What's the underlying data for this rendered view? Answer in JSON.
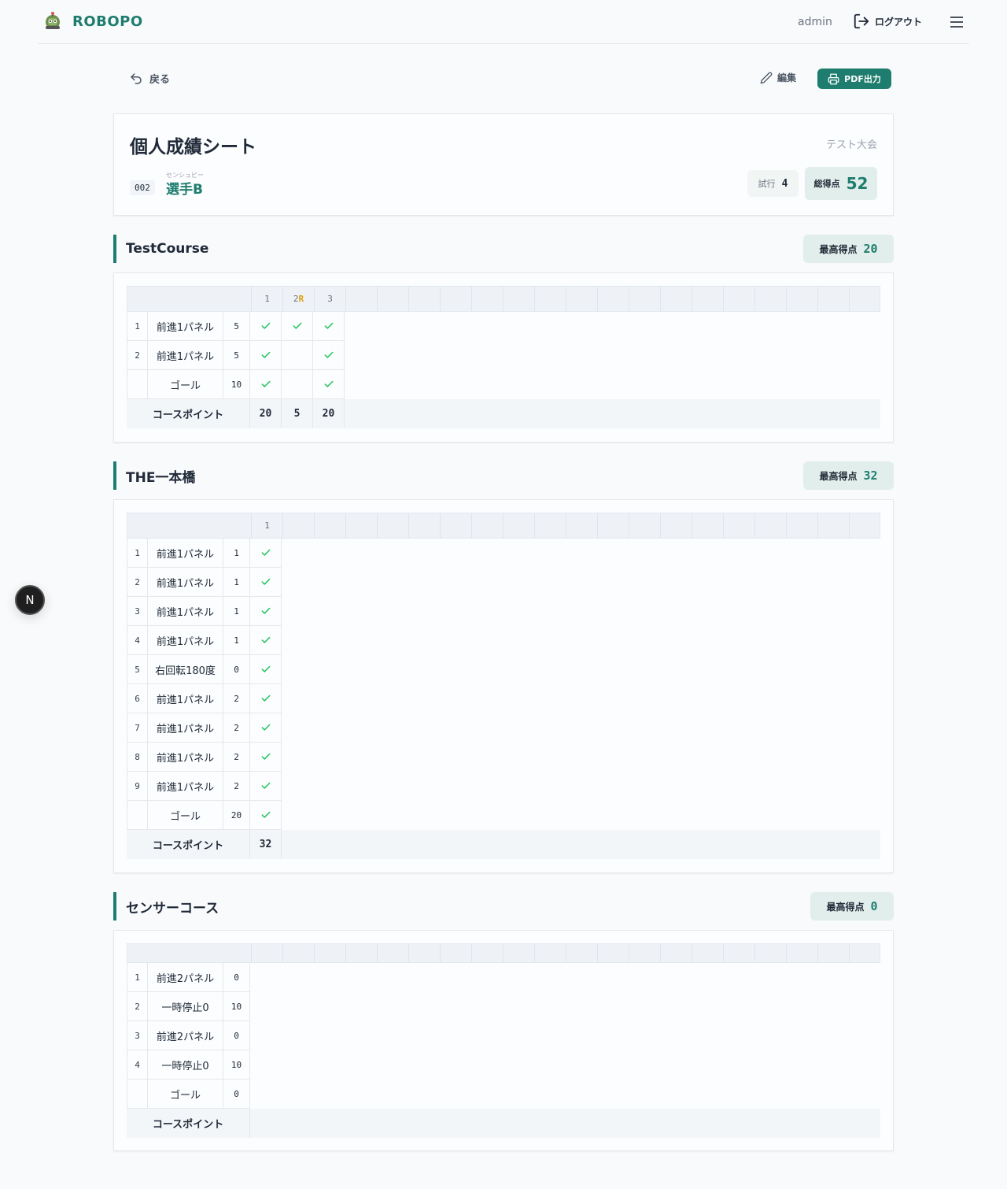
{
  "header": {
    "brand": "ROBOPO",
    "user": "admin",
    "logout_label": "ログアウト"
  },
  "toolbar": {
    "back_label": "戻る",
    "edit_label": "編集",
    "pdf_label": "PDF出力"
  },
  "sheet": {
    "title": "個人成績シート",
    "event_name": "テスト大会",
    "bib": "002",
    "ruby": "センシュビー",
    "player_name": "選手B",
    "trial_label": "試行",
    "trial_value": "4",
    "total_label": "総得点",
    "total_value": "52"
  },
  "best_label": "最高得点",
  "point_label": "コースポイント",
  "courses": [
    {
      "name": "TestCourse",
      "best": "20",
      "attempts": [
        {
          "n": "1",
          "r": ""
        },
        {
          "n": "2",
          "r": "R"
        },
        {
          "n": "3",
          "r": ""
        }
      ],
      "rows": [
        {
          "num": "1",
          "name": "前進1パネル",
          "pts": "5",
          "checks": [
            true,
            true,
            true
          ]
        },
        {
          "num": "2",
          "name": "前進1パネル",
          "pts": "5",
          "checks": [
            true,
            false,
            true
          ]
        },
        {
          "num": "",
          "name": "ゴール",
          "pts": "10",
          "checks": [
            true,
            false,
            true
          ]
        }
      ],
      "points": [
        "20",
        "5",
        "20"
      ]
    },
    {
      "name": "THE一本橋",
      "best": "32",
      "attempts": [
        {
          "n": "1",
          "r": ""
        }
      ],
      "rows": [
        {
          "num": "1",
          "name": "前進1パネル",
          "pts": "1",
          "checks": [
            true
          ]
        },
        {
          "num": "2",
          "name": "前進1パネル",
          "pts": "1",
          "checks": [
            true
          ]
        },
        {
          "num": "3",
          "name": "前進1パネル",
          "pts": "1",
          "checks": [
            true
          ]
        },
        {
          "num": "4",
          "name": "前進1パネル",
          "pts": "1",
          "checks": [
            true
          ]
        },
        {
          "num": "5",
          "name": "右回転180度",
          "pts": "0",
          "checks": [
            true
          ]
        },
        {
          "num": "6",
          "name": "前進1パネル",
          "pts": "2",
          "checks": [
            true
          ]
        },
        {
          "num": "7",
          "name": "前進1パネル",
          "pts": "2",
          "checks": [
            true
          ]
        },
        {
          "num": "8",
          "name": "前進1パネル",
          "pts": "2",
          "checks": [
            true
          ]
        },
        {
          "num": "9",
          "name": "前進1パネル",
          "pts": "2",
          "checks": [
            true
          ]
        },
        {
          "num": "",
          "name": "ゴール",
          "pts": "20",
          "checks": [
            true
          ]
        }
      ],
      "points": [
        "32"
      ]
    },
    {
      "name": "センサーコース",
      "best": "0",
      "attempts": [],
      "rows": [
        {
          "num": "1",
          "name": "前進2パネル",
          "pts": "0",
          "checks": []
        },
        {
          "num": "2",
          "name": "一時停止0",
          "pts": "10",
          "checks": []
        },
        {
          "num": "3",
          "name": "前進2パネル",
          "pts": "0",
          "checks": []
        },
        {
          "num": "4",
          "name": "一時停止0",
          "pts": "10",
          "checks": []
        },
        {
          "num": "",
          "name": "ゴール",
          "pts": "0",
          "checks": []
        }
      ],
      "points": []
    }
  ],
  "dev_badge": "N",
  "colors": {
    "accent": "#1e7d6e",
    "check": "#22c55e",
    "retry": "#e0a008"
  },
  "icons": {
    "logo": "robot-logo-icon",
    "logout": "logout-icon",
    "menu": "hamburger-menu-icon",
    "back": "undo-arrow-icon",
    "edit": "pencil-icon",
    "pdf": "printer-icon",
    "check": "check-icon"
  }
}
